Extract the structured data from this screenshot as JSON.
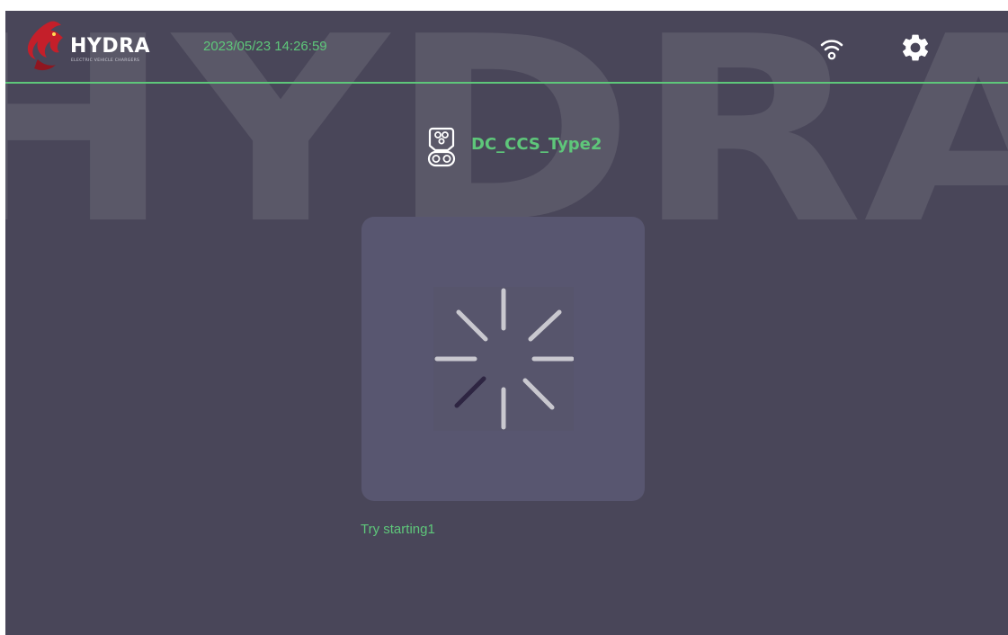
{
  "brand": {
    "name": "HYDRA",
    "tagline": "ELECTRIC VEHICLE CHARGERS",
    "watermark_text": "HYDRA"
  },
  "header": {
    "datetime": "2023/05/23 14:26:59",
    "wifi_icon": "wifi-icon",
    "settings_icon": "gear-icon"
  },
  "connector": {
    "icon": "ev-plug-ccs-icon",
    "name": "DC_CCS_Type2"
  },
  "loading": {
    "icon": "loading-spinner-icon",
    "status": "Try starting1"
  },
  "colors": {
    "background": "#494659",
    "accent_green": "#5ec77a",
    "card": "#585670",
    "spinner_tick": "#c9c8cf",
    "spinner_active_tick": "#2e2542",
    "watermark": "#5a5868"
  }
}
